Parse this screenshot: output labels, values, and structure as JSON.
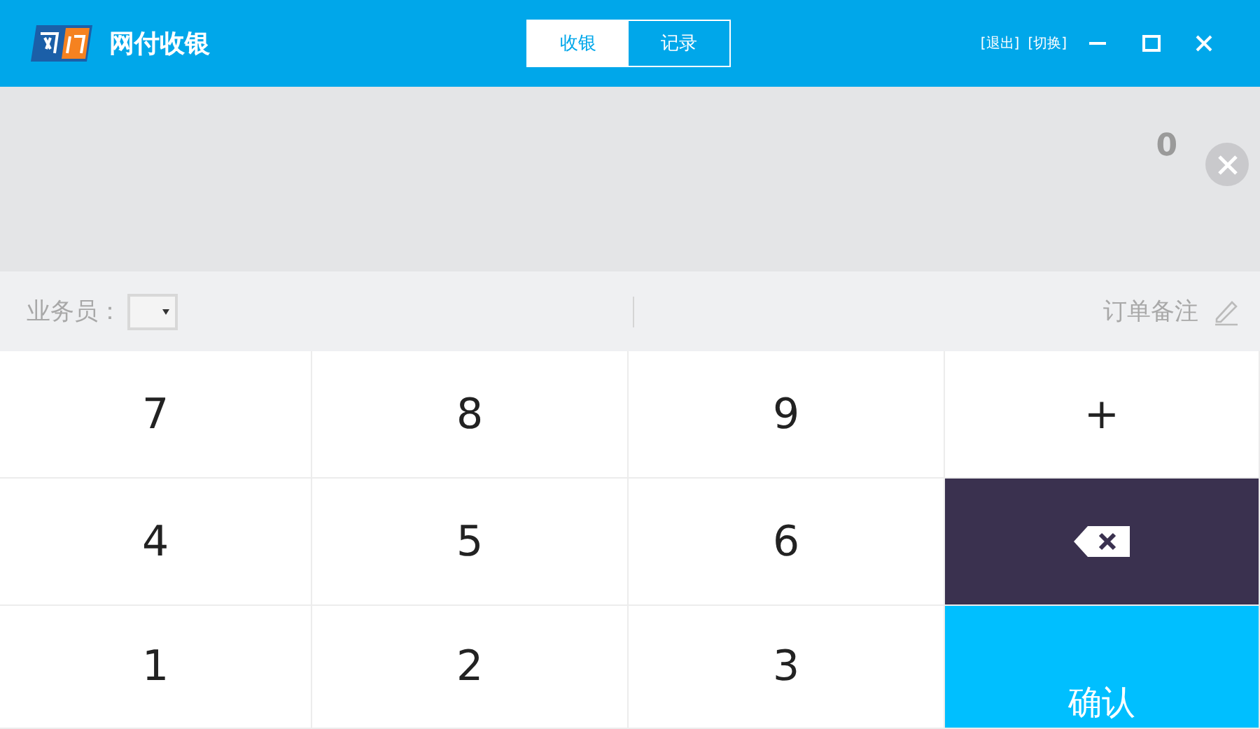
{
  "app": {
    "title": "网付收银"
  },
  "tabs": [
    {
      "label": "收银",
      "selected": true
    },
    {
      "label": "记录",
      "selected": false
    }
  ],
  "header_links": [
    "[退出]",
    "[切换]"
  ],
  "display": {
    "amount": "0"
  },
  "toolbar": {
    "staff_label": "业务员：",
    "note_label": "订单备注"
  },
  "keys": [
    {
      "kind": "digit",
      "label": "7"
    },
    {
      "kind": "digit",
      "label": "8"
    },
    {
      "kind": "digit",
      "label": "9"
    },
    {
      "kind": "op",
      "label": "+"
    },
    {
      "kind": "digit",
      "label": "4"
    },
    {
      "kind": "digit",
      "label": "5"
    },
    {
      "kind": "digit",
      "label": "6"
    },
    {
      "kind": "backspace"
    },
    {
      "kind": "digit",
      "label": "1"
    },
    {
      "kind": "digit",
      "label": "2"
    },
    {
      "kind": "digit",
      "label": "3"
    },
    {
      "kind": "confirm",
      "label": "确认"
    }
  ]
}
